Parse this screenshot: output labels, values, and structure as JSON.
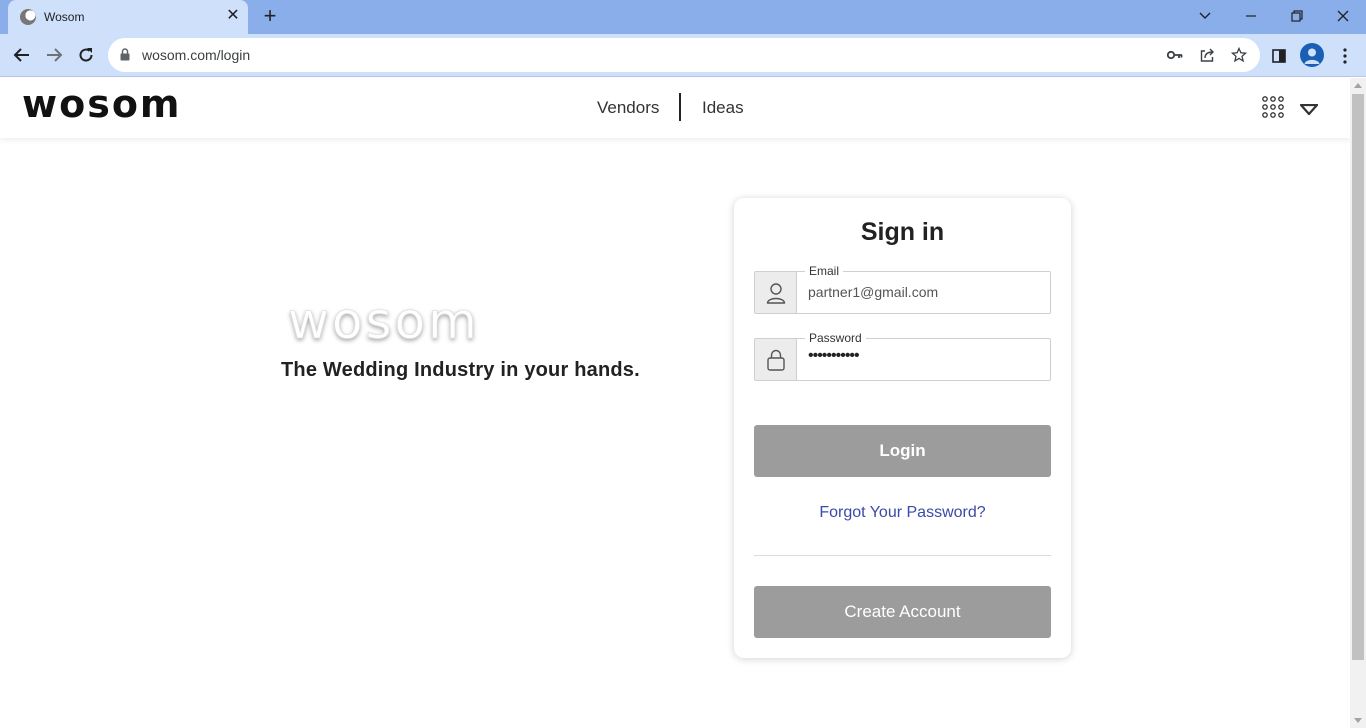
{
  "browser": {
    "tab_title": "Wosom",
    "url": "wosom.com/login",
    "icons": [
      "tab-close-icon",
      "new-tab-icon",
      "chevron-down-icon",
      "minimize-icon",
      "restore-icon",
      "close-icon",
      "back-icon",
      "forward-icon",
      "reload-icon",
      "lock-icon",
      "key-icon",
      "share-icon",
      "star-icon",
      "side-panel-icon",
      "profile-icon",
      "kebab-menu-icon"
    ]
  },
  "header": {
    "logo_text": "wosom",
    "nav": [
      {
        "label": "Vendors"
      },
      {
        "label": "Ideas"
      }
    ],
    "icons": [
      "apps-grid-icon",
      "caret-down-icon"
    ]
  },
  "hero": {
    "logo_text": "wosom",
    "tagline": "The Wedding Industry in your hands."
  },
  "login": {
    "title": "Sign in",
    "email_label": "Email",
    "email_value": "partner1@gmail.com",
    "password_label": "Password",
    "password_mask": "•••••••••••",
    "login_button": "Login",
    "forgot_link": "Forgot Your Password?",
    "create_button": "Create Account"
  },
  "colors": {
    "tabbar": "#8aaee9",
    "toolbar": "#cfe0fb",
    "button_gray": "#9c9c9c",
    "link_blue": "#3a4aa8"
  }
}
